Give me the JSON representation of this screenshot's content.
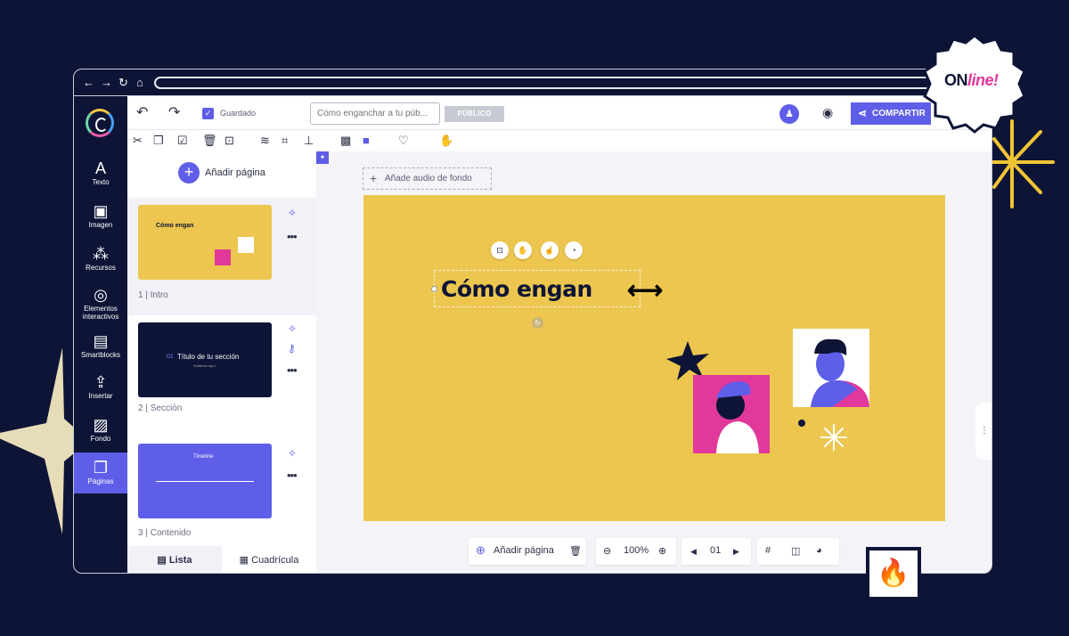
{
  "badge": {
    "text_strong": "ON",
    "text_script": "line!"
  },
  "browser": {
    "nav": {
      "back": "←",
      "forward": "→",
      "reload": "↻",
      "home": "⌂"
    }
  },
  "rail": {
    "items": [
      {
        "label": "Texto",
        "icon": "text-icon",
        "glyph": "A"
      },
      {
        "label": "Imagen",
        "icon": "image-icon",
        "glyph": "▣"
      },
      {
        "label": "Recursos",
        "icon": "resources-icon",
        "glyph": "⁂"
      },
      {
        "label": "Elementos interactivos",
        "icon": "interactive-icon",
        "glyph": "◎"
      },
      {
        "label": "Smartblocks",
        "icon": "smartblocks-icon",
        "glyph": "▤"
      },
      {
        "label": "Insertar",
        "icon": "insert-icon",
        "glyph": "⇪"
      },
      {
        "label": "Fondo",
        "icon": "background-icon",
        "glyph": "▨"
      },
      {
        "label": "Páginas",
        "icon": "pages-icon",
        "glyph": "❐"
      }
    ],
    "active": "Páginas"
  },
  "topbar": {
    "saved_label": "Guardado",
    "title_placeholder": "Cómo enganchar a tu púb...",
    "public_label": "PÚBLICO",
    "share_label": "COMPARTIR"
  },
  "pages": {
    "add_label": "Añadir página",
    "items": [
      {
        "label": "1 | Intro",
        "thumb_title": "Cómo engan"
      },
      {
        "label": "2 | Sección",
        "thumb_num": "01",
        "thumb_title": "Título de tu sección",
        "thumb_sub": "Subtítulo aquí"
      },
      {
        "label": "3 | Contenido",
        "thumb_title": "Timeline"
      }
    ],
    "tabs": {
      "list": "Lista",
      "grid": "Cuadrícula"
    }
  },
  "canvas": {
    "audio_label": "Añade audio de fondo",
    "slide_title": "Cómo engan",
    "bottom": {
      "add_page": "Añadir página",
      "zoom": "100%",
      "page": "01"
    }
  },
  "colors": {
    "navy": "#0d1436",
    "accent": "#5e5ee8",
    "slide_bg": "#ecc64e",
    "pink": "#e0399b"
  }
}
